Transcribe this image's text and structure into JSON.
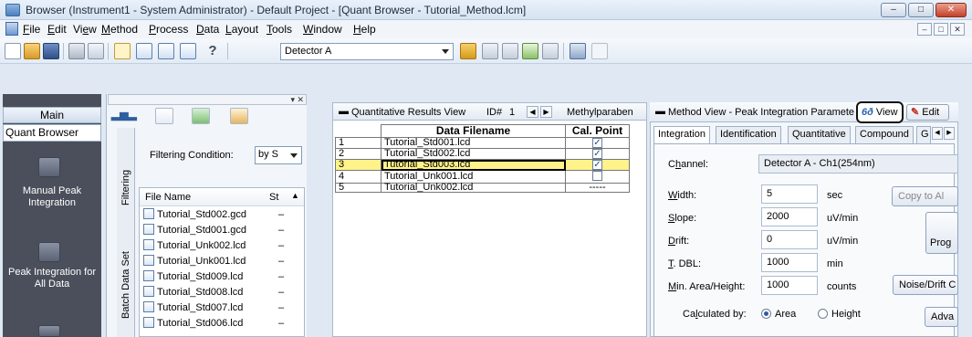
{
  "window": {
    "title": "Browser (Instrument1 - System Administrator) - Default Project - [Quant Browser - Tutorial_Method.lcm]",
    "controls": [
      "–",
      "□",
      "✕"
    ],
    "mdi_controls": [
      "–",
      "□",
      "✕"
    ]
  },
  "menu": [
    {
      "accel": "F",
      "rest": "ile"
    },
    {
      "accel": "E",
      "rest": "dit"
    },
    {
      "accel": "V",
      "rest": "iew",
      "accel_pos": "after1"
    },
    {
      "accel": "M",
      "rest": "ethod"
    },
    {
      "accel": "P",
      "rest": "rocess"
    },
    {
      "accel": "D",
      "rest": "ata"
    },
    {
      "accel": "L",
      "rest": "ayout"
    },
    {
      "accel": "T",
      "rest": "ools"
    },
    {
      "accel": "W",
      "rest": "indow"
    },
    {
      "accel": "H",
      "rest": "elp"
    }
  ],
  "menu_labels": [
    "File",
    "Edit",
    "View",
    "Method",
    "Process",
    "Data",
    "Layout",
    "Tools",
    "Window",
    "Help"
  ],
  "toolbar": {
    "help_glyph": "?",
    "detector": "Detector A"
  },
  "leftnav": {
    "header": "Main",
    "selected": "Quant Browser",
    "items": [
      {
        "label": "Manual Peak Integration"
      },
      {
        "label": "Peak Integration for All Data"
      }
    ]
  },
  "filepane": {
    "tabs": [
      "Filtering",
      "Batch Data Set"
    ],
    "filter_label": "Filtering Condition:",
    "filter_value": "by S",
    "columns": [
      "File Name",
      "St"
    ],
    "files": [
      {
        "name": "Tutorial_Std002.gcd",
        "status": "–"
      },
      {
        "name": "Tutorial_Std001.gcd",
        "status": "–"
      },
      {
        "name": "Tutorial_Unk002.lcd",
        "status": "–"
      },
      {
        "name": "Tutorial_Unk001.lcd",
        "status": "–"
      },
      {
        "name": "Tutorial_Std009.lcd",
        "status": "–"
      },
      {
        "name": "Tutorial_Std008.lcd",
        "status": "–"
      },
      {
        "name": "Tutorial_Std007.lcd",
        "status": "–"
      },
      {
        "name": "Tutorial_Std006.lcd",
        "status": "–"
      }
    ]
  },
  "results": {
    "title": "Quantitative Results View",
    "id_label": "ID#",
    "id_value": "1",
    "compound": "Methylparaben",
    "columns": [
      "Data Filename",
      "Cal. Point"
    ],
    "rows": [
      {
        "n": "1",
        "file": "Tutorial_Std001.lcd",
        "cal": "checked"
      },
      {
        "n": "2",
        "file": "Tutorial_Std002.lcd",
        "cal": "checked"
      },
      {
        "n": "3",
        "file": "Tutorial_Std003.lcd",
        "cal": "checked",
        "selected": true
      },
      {
        "n": "4",
        "file": "Tutorial_Unk001.lcd",
        "cal": "unchecked"
      },
      {
        "n": "5",
        "file": "Tutorial_Unk002.lcd",
        "cal": "-----"
      }
    ],
    "selected_row_color": "#fff38a"
  },
  "method": {
    "title": "Method View - Peak Integration Paramete",
    "view_button": "View",
    "edit_button": "Edit",
    "tabs": [
      "Integration",
      "Identification",
      "Quantitative",
      "Compound",
      "G"
    ],
    "channel_label": "Channel:",
    "channel_value": "Detector A - Ch1(254nm)",
    "fields": [
      {
        "label": "Width:",
        "value": "5",
        "unit": "sec"
      },
      {
        "label": "Slope:",
        "value": "2000",
        "unit": "uV/min"
      },
      {
        "label": "Drift:",
        "value": "0",
        "unit": "uV/min"
      },
      {
        "label": "T. DBL:",
        "value": "1000",
        "unit": "min"
      },
      {
        "label": "Min. Area/Height:",
        "value": "1000",
        "unit": "counts"
      }
    ],
    "calculated_by_label": "Calculated by:",
    "calc_options": [
      "Area",
      "Height"
    ],
    "calc_selected": "Area",
    "buttons": {
      "copy_to_all": "Copy to Al",
      "prog": "Prog",
      "noise_drift": "Noise/Drift C",
      "adv": "Adva"
    }
  }
}
